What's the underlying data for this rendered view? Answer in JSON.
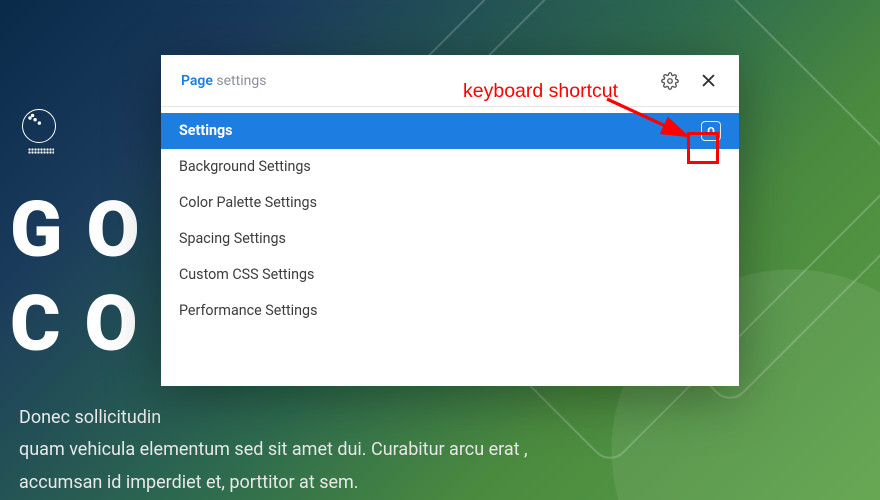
{
  "annotation": {
    "label": "keyboard shortcut",
    "color": "#ff0000"
  },
  "modal": {
    "header": {
      "title_highlight": "Page",
      "title_rest": " settings",
      "gear_icon": "gear-icon",
      "close_icon": "close-icon"
    },
    "list": [
      {
        "label": "Settings",
        "active": true,
        "shortcut": "O"
      },
      {
        "label": "Background Settings",
        "active": false
      },
      {
        "label": "Color Palette Settings",
        "active": false
      },
      {
        "label": "Spacing Settings",
        "active": false
      },
      {
        "label": "Custom CSS Settings",
        "active": false
      },
      {
        "label": "Performance Settings",
        "active": false
      }
    ]
  },
  "hero": {
    "line1": "GOI",
    "line2": "COU"
  },
  "paragraph": {
    "line1": "Donec sollicitudin",
    "line2": "quam vehicula elementum sed sit amet dui. Curabitur arcu erat ,",
    "line3": "accumsan id imperdiet et, porttitor at sem."
  },
  "colors": {
    "accent": "#1e7de0",
    "annotation": "#ff0000"
  }
}
